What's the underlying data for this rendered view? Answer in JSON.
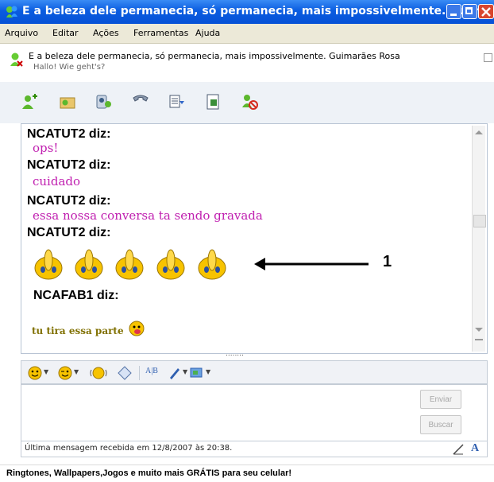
{
  "window": {
    "title": "E a beleza dele permanecia, só permanecia, mais impossivelmente. Guimarã..."
  },
  "menu": [
    "Arquivo",
    "Editar",
    "Ações",
    "Ferramentas",
    "Ajuda"
  ],
  "contact": {
    "name": "E a beleza dele permanecia, só permanecia, mais impossivelmente. Guimarães Rosa",
    "status": "Hallo! Wie geht's?"
  },
  "chat": {
    "messages": [
      {
        "speaker": "NCATUT2 diz:",
        "text": "ops!"
      },
      {
        "speaker": "NCATUT2 diz:",
        "text": "cuidado"
      },
      {
        "speaker": "NCATUT2 diz:",
        "text": "essa nossa conversa ta sendo gravada"
      },
      {
        "speaker": "NCATUT2 diz:",
        "text": ""
      },
      {
        "speaker": "NCAFAB1 diz:",
        "text": "tu tira essa parte"
      }
    ],
    "annotation_number": "1",
    "scroll_dots": "........"
  },
  "buttons": {
    "send": "Enviar",
    "search": "Buscar"
  },
  "status": {
    "last_message": "Última mensagem recebida em 12/8/2007 às 20:38."
  },
  "ad": {
    "text": "Ringtones, Wallpapers,Jogos e muito mais GRÁTIS para seu celular!"
  },
  "colors": {
    "title_bar": "#0a5ce0",
    "message_pink": "#c020b0",
    "message_olive": "#807000"
  }
}
